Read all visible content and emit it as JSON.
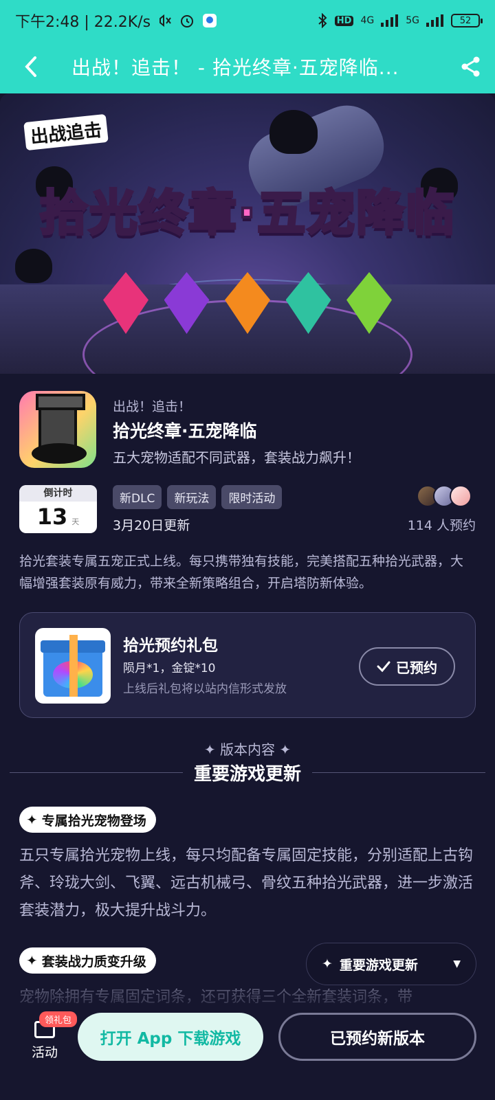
{
  "status_bar": {
    "time_speed": "下午2:48 | 22.2K/s",
    "network": "4G",
    "network2": "5G",
    "battery": "52"
  },
  "nav": {
    "title": "出战！追击！ - 拾光终章·五宠降临..."
  },
  "banner": {
    "logo_text": "出战追击",
    "title": "拾光终章·五宠降临"
  },
  "app": {
    "subtitle": "出战！追击！",
    "name": "拾光终章·五宠降临",
    "description": "五大宠物适配不同武器，套装战力飙升！"
  },
  "countdown": {
    "label": "倒计时",
    "value": "13",
    "unit": "天"
  },
  "tags": [
    "新DLC",
    "新玩法",
    "限时活动"
  ],
  "update_date": "3月20日更新",
  "reserve_count": "114 人预约",
  "intro": "拾光套装专属五宠正式上线。每只携带独有技能，完美搭配五种拾光武器，大幅增强套装原有威力，带来全新策略组合，开启塔防新体验。",
  "gift": {
    "title": "拾光预约礼包",
    "items": "陨月*1，金锭*10",
    "note": "上线后礼包将以站内信形式发放",
    "button": "已预约"
  },
  "section": {
    "label": "✦ 版本内容 ✦",
    "title": "重要游戏更新"
  },
  "features": [
    {
      "title": "专属拾光宠物登场",
      "text": "五只专属拾光宠物上线，每只均配备专属固定技能，分别适配上古钩斧、玲珑大剑、飞翼、远古机械弓、骨纹五种拾光武器，进一步激活套装潜力，极大提升战斗力。"
    },
    {
      "title": "套装战力质变升级",
      "text": "宠物除拥有专属固定词条，还可获得三个全新套装词条，带"
    }
  ],
  "float_nav": {
    "label": "重要游戏更新"
  },
  "bottom": {
    "activity_label": "活动",
    "gift_badge": "领礼包",
    "open_app": "打开 App 下载游戏",
    "reserved_version": "已预约新版本"
  },
  "colors": {
    "accent": "#2fdcc7",
    "background": "#16162e"
  }
}
